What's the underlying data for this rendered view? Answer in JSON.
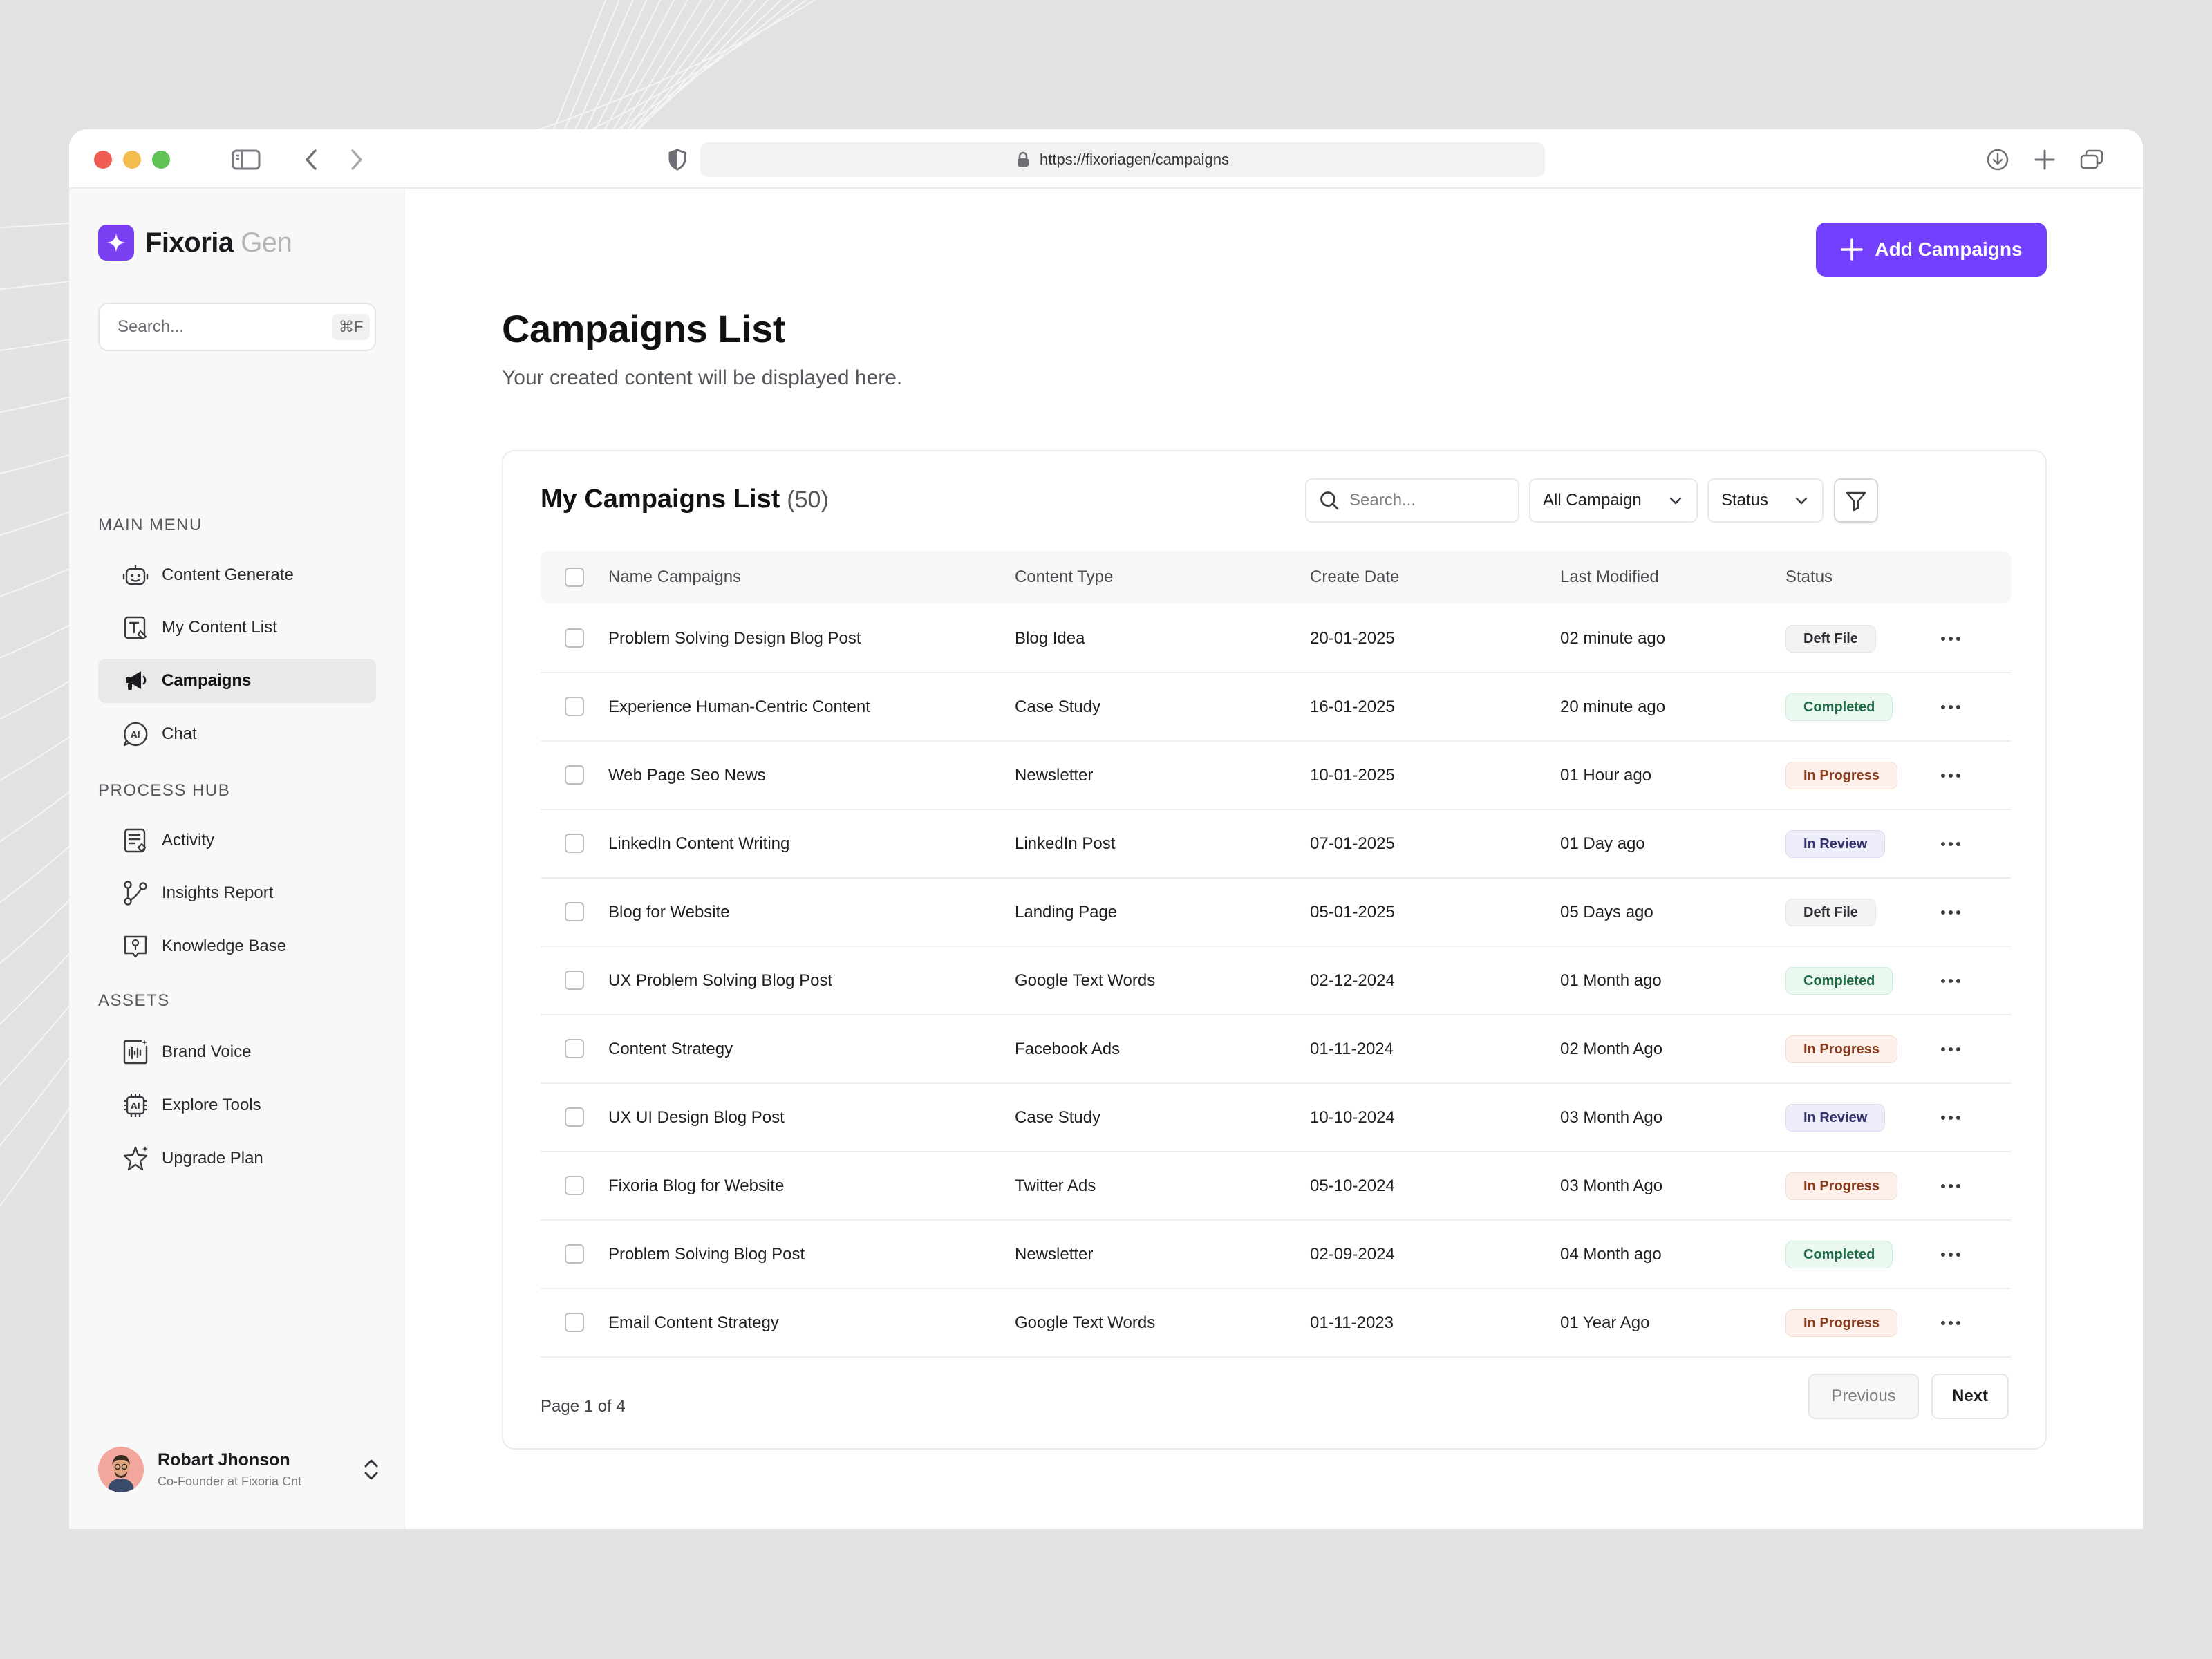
{
  "browser": {
    "url": "https://fixoriagen/campaigns"
  },
  "brand": {
    "name": "Fixoria",
    "suffix": "Gen",
    "accent": "#7440ff"
  },
  "sidebar": {
    "search_placeholder": "Search...",
    "search_shortcut": "⌘F",
    "sections": [
      {
        "label": "MAIN MENU"
      },
      {
        "label": "PROCESS HUB"
      },
      {
        "label": "ASSETS"
      }
    ],
    "items": [
      {
        "label": "Content Generate",
        "icon": "robot-icon"
      },
      {
        "label": "My Content List",
        "icon": "text-edit-icon"
      },
      {
        "label": "Campaigns",
        "icon": "megaphone-icon",
        "active": true
      },
      {
        "label": "Chat",
        "icon": "ai-chat-icon"
      },
      {
        "label": "Activity",
        "icon": "activity-icon"
      },
      {
        "label": "Insights Report",
        "icon": "insights-icon"
      },
      {
        "label": "Knowledge Base",
        "icon": "knowledge-base-icon"
      },
      {
        "label": "Brand Voice",
        "icon": "brand-voice-icon"
      },
      {
        "label": "Explore Tools",
        "icon": "ai-chip-icon"
      },
      {
        "label": "Upgrade Plan",
        "icon": "sparkle-star-icon"
      }
    ],
    "user": {
      "name": "Robart Jhonson",
      "role": "Co-Founder at Fixoria Cnt"
    }
  },
  "main": {
    "add_button": "Add Campaigns",
    "title": "Campaigns List",
    "subtitle": "Your created content will be displayed here."
  },
  "table": {
    "title": "My Campaigns List",
    "count": "(50)",
    "search_placeholder": "Search...",
    "filter_campaign": "All Campaign",
    "filter_status": "Status",
    "columns": [
      "Name Campaigns",
      "Content Type",
      "Create Date",
      "Last Modified",
      "Status"
    ],
    "rows": [
      {
        "name": "Problem Solving Design Blog Post",
        "type": "Blog Idea",
        "created": "20-01-2025",
        "modified": "02 minute ago",
        "status": "Deft File"
      },
      {
        "name": "Experience Human-Centric Content",
        "type": "Case Study",
        "created": "16-01-2025",
        "modified": "20 minute ago",
        "status": "Completed"
      },
      {
        "name": "Web Page Seo News",
        "type": "Newsletter",
        "created": "10-01-2025",
        "modified": "01 Hour ago",
        "status": "In Progress"
      },
      {
        "name": "LinkedIn Content Writing",
        "type": "LinkedIn Post",
        "created": "07-01-2025",
        "modified": "01 Day ago",
        "status": "In Review"
      },
      {
        "name": "Blog for Website",
        "type": "Landing Page",
        "created": "05-01-2025",
        "modified": "05 Days ago",
        "status": "Deft File"
      },
      {
        "name": "UX Problem Solving Blog Post",
        "type": "Google Text Words",
        "created": "02-12-2024",
        "modified": "01 Month ago",
        "status": "Completed"
      },
      {
        "name": "Content Strategy",
        "type": "Facebook Ads",
        "created": "01-11-2024",
        "modified": "02 Month Ago",
        "status": "In Progress"
      },
      {
        "name": "UX UI Design Blog Post",
        "type": "Case Study",
        "created": "10-10-2024",
        "modified": "03 Month Ago",
        "status": "In Review"
      },
      {
        "name": "Fixoria Blog for Website",
        "type": "Twitter Ads",
        "created": "05-10-2024",
        "modified": "03 Month Ago",
        "status": "In Progress"
      },
      {
        "name": "Problem Solving Blog Post",
        "type": "Newsletter",
        "created": "02-09-2024",
        "modified": "04 Month ago",
        "status": "Completed"
      },
      {
        "name": "Email Content Strategy",
        "type": "Google Text Words",
        "created": "01-11-2023",
        "modified": "01 Year Ago",
        "status": "In Progress"
      }
    ],
    "status_colors": {
      "Deft File": {
        "bg": "#f3f3f4",
        "fg": "#2d2d33",
        "border": "#e6e6e8"
      },
      "Completed": {
        "bg": "#eaf8f0",
        "fg": "#1f6b45",
        "border": "#cdeedb"
      },
      "In Progress": {
        "bg": "#fdf0ea",
        "fg": "#8a3d1e",
        "border": "#f6ddd0"
      },
      "In Review": {
        "bg": "#eeeefb",
        "fg": "#34346e",
        "border": "#dcdcf3"
      }
    },
    "pagination": {
      "text": "Page 1 of 4",
      "previous": "Previous",
      "next": "Next"
    }
  }
}
